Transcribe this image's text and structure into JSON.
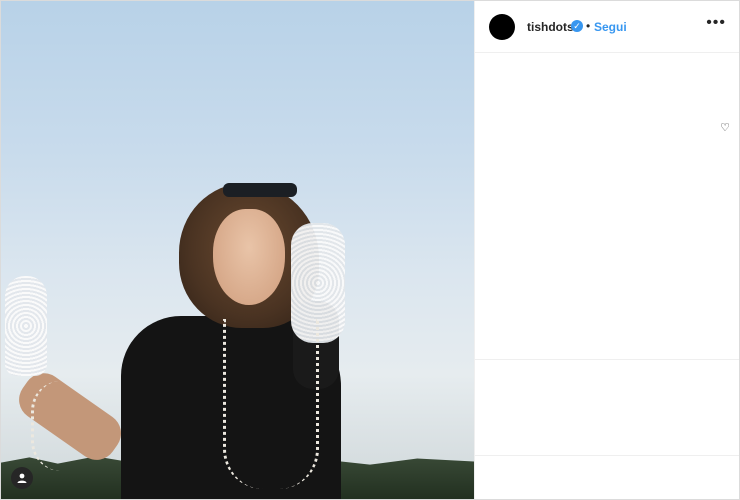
{
  "post": {
    "username": "tishdots",
    "verified_icon": "verified-badge-icon",
    "separator": "•",
    "follow_label": "Segui",
    "more_icon_text": "•••",
    "like_icon_text": "♡"
  },
  "photo": {
    "user_tag_icon": "person-icon"
  },
  "colors": {
    "accent": "#3897f0",
    "text": "#262626",
    "border": "#efefef"
  }
}
